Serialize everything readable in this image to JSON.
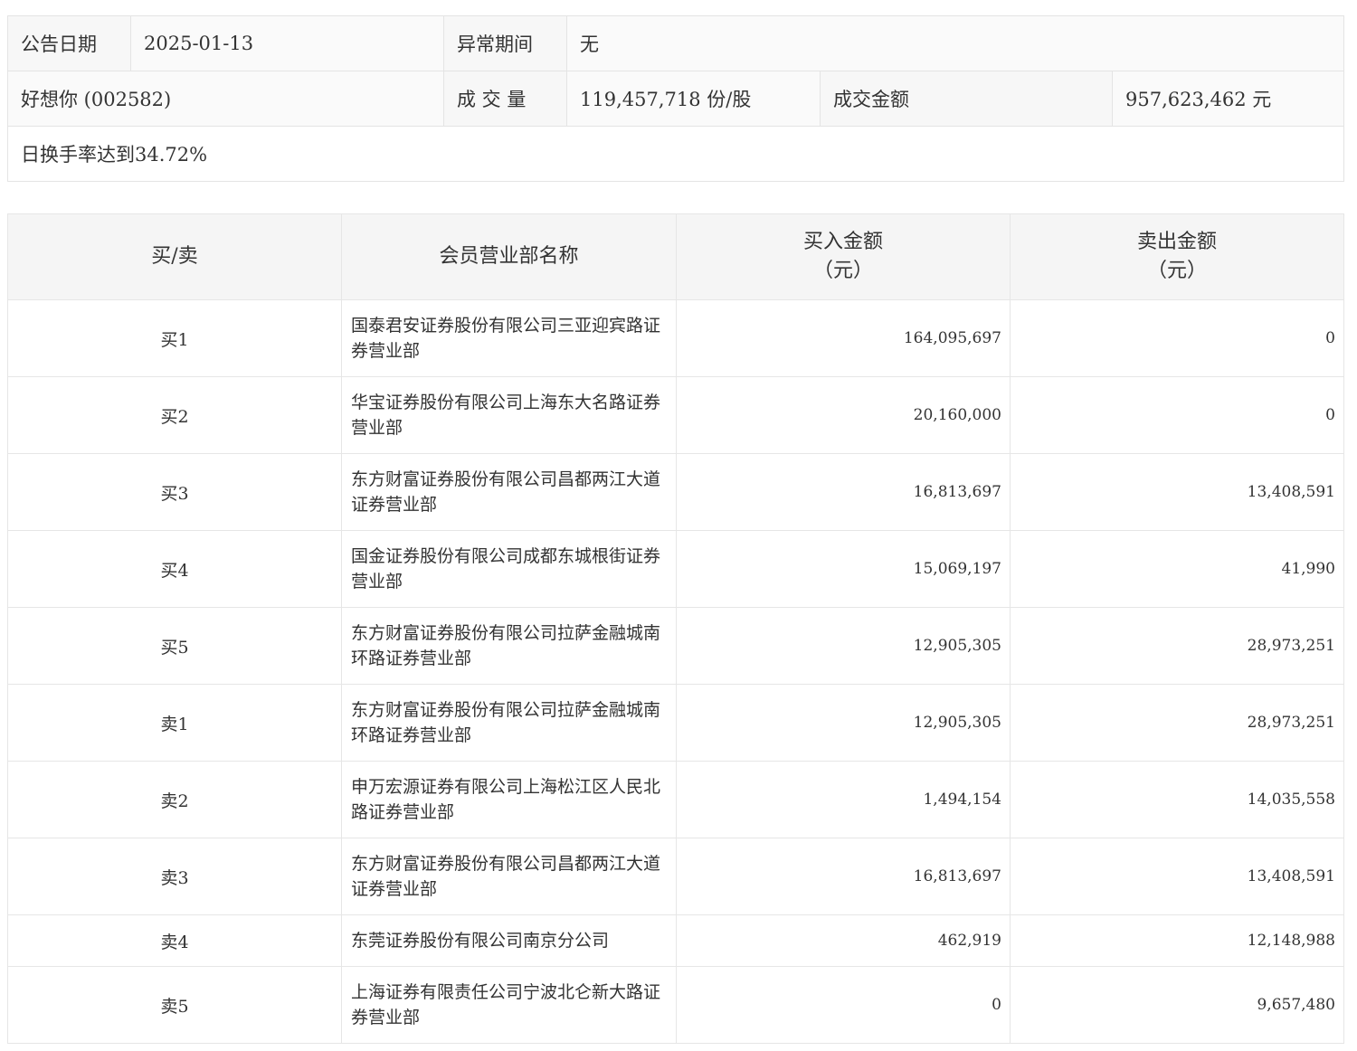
{
  "summary": {
    "date_label": "公告日期",
    "date_value": "2025-01-13",
    "period_label": "异常期间",
    "period_value": "无",
    "stock": "好想你 (002582)",
    "volume_label": "成 交 量",
    "volume_value": "119,457,718 份/股",
    "amount_label": "成交金额",
    "amount_value": "957,623,462 元",
    "note": "日换手率达到34.72%"
  },
  "detail": {
    "headers": {
      "side": "买/卖",
      "member": "会员营业部名称",
      "buy": "买入金额",
      "buy_unit": "（元）",
      "sell": "卖出金额",
      "sell_unit": "（元）"
    },
    "rows": [
      {
        "side": "买1",
        "name": "国泰君安证券股份有限公司三亚迎宾路证券营业部",
        "buy": "164,095,697",
        "sell": "0"
      },
      {
        "side": "买2",
        "name": "华宝证券股份有限公司上海东大名路证券营业部",
        "buy": "20,160,000",
        "sell": "0"
      },
      {
        "side": "买3",
        "name": "东方财富证券股份有限公司昌都两江大道证券营业部",
        "buy": "16,813,697",
        "sell": "13,408,591"
      },
      {
        "side": "买4",
        "name": "国金证券股份有限公司成都东城根街证券营业部",
        "buy": "15,069,197",
        "sell": "41,990"
      },
      {
        "side": "买5",
        "name": "东方财富证券股份有限公司拉萨金融城南环路证券营业部",
        "buy": "12,905,305",
        "sell": "28,973,251"
      },
      {
        "side": "卖1",
        "name": "东方财富证券股份有限公司拉萨金融城南环路证券营业部",
        "buy": "12,905,305",
        "sell": "28,973,251"
      },
      {
        "side": "卖2",
        "name": "申万宏源证券有限公司上海松江区人民北路证券营业部",
        "buy": "1,494,154",
        "sell": "14,035,558"
      },
      {
        "side": "卖3",
        "name": "东方财富证券股份有限公司昌都两江大道证券营业部",
        "buy": "16,813,697",
        "sell": "13,408,591"
      },
      {
        "side": "卖4",
        "name": "东莞证券股份有限公司南京分公司",
        "buy": "462,919",
        "sell": "12,148,988"
      },
      {
        "side": "卖5",
        "name": "上海证券有限责任公司宁波北仑新大路证券营业部",
        "buy": "0",
        "sell": "9,657,480"
      }
    ]
  }
}
